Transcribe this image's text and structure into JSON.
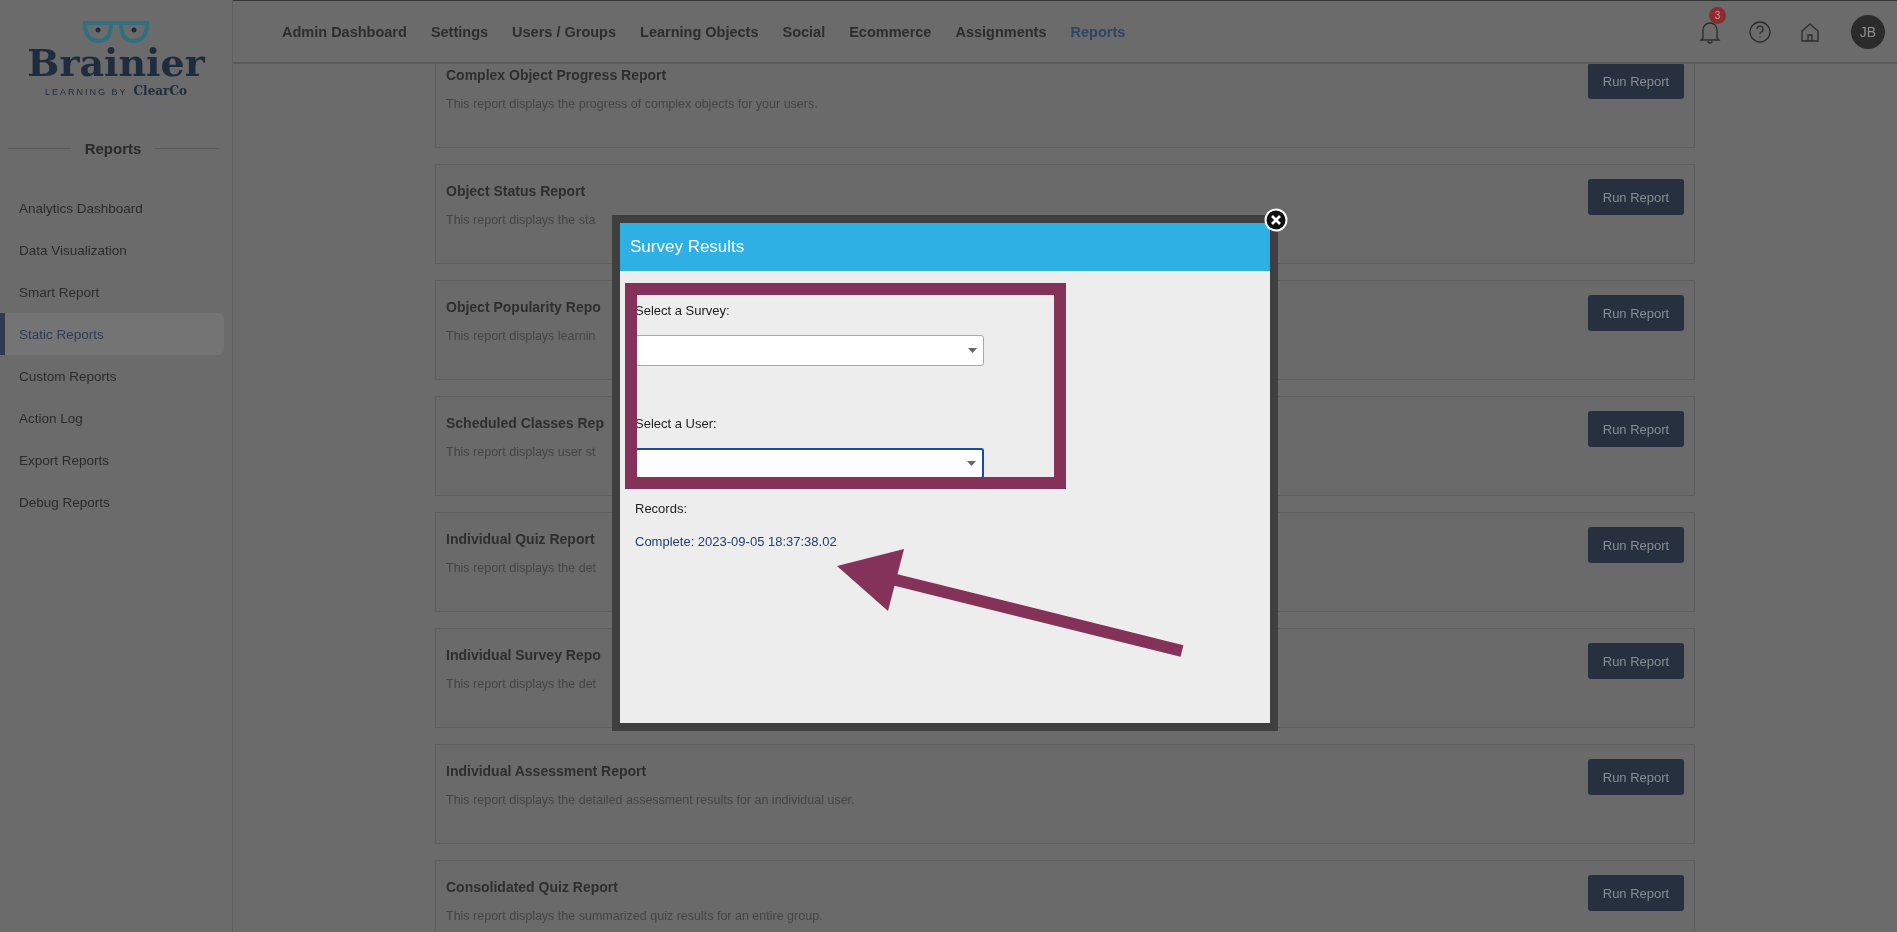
{
  "logo": {
    "name": "Brainier",
    "tagline": "LEARNING BY",
    "brand": "ClearCo"
  },
  "nav": [
    {
      "label": "Admin Dashboard",
      "selected": false
    },
    {
      "label": "Settings",
      "selected": false
    },
    {
      "label": "Users / Groups",
      "selected": false
    },
    {
      "label": "Learning Objects",
      "selected": false
    },
    {
      "label": "Social",
      "selected": false
    },
    {
      "label": "Ecommerce",
      "selected": false
    },
    {
      "label": "Assignments",
      "selected": false
    },
    {
      "label": "Reports",
      "selected": true
    }
  ],
  "header": {
    "notification_count": "3",
    "avatar": "JB"
  },
  "sidebar": {
    "heading": "Reports",
    "items": [
      {
        "label": "Analytics Dashboard",
        "selected": false
      },
      {
        "label": "Data Visualization",
        "selected": false
      },
      {
        "label": "Smart Report",
        "selected": false
      },
      {
        "label": "Static Reports",
        "selected": true
      },
      {
        "label": "Custom Reports",
        "selected": false
      },
      {
        "label": "Action Log",
        "selected": false
      },
      {
        "label": "Export Reports",
        "selected": false
      },
      {
        "label": "Debug Reports",
        "selected": false
      }
    ]
  },
  "reports": [
    {
      "title": "Complex Object Progress Report",
      "description": "This report displays the progress of complex objects for your users.",
      "button": "Run Report"
    },
    {
      "title": "Object Status Report",
      "description": "This report displays the sta",
      "button": "Run Report"
    },
    {
      "title": "Object Popularity Repo",
      "description": "This report displays learnin",
      "button": "Run Report"
    },
    {
      "title": "Scheduled Classes Rep",
      "description": "This report displays user st",
      "button": "Run Report"
    },
    {
      "title": "Individual Quiz Report",
      "description": "This report displays the det",
      "button": "Run Report"
    },
    {
      "title": "Individual Survey Repo",
      "description": "This report displays the det",
      "button": "Run Report"
    },
    {
      "title": "Individual Assessment Report",
      "description": "This report displays the detailed assessment results for an individual user.",
      "button": "Run Report"
    },
    {
      "title": "Consolidated Quiz Report",
      "description": "This report displays the summarized quiz results for an entire group.",
      "button": "Run Report"
    }
  ],
  "modal": {
    "title": "Survey Results",
    "fields": [
      {
        "label": "Select a Survey:",
        "focused": false
      },
      {
        "label": "Select a User:",
        "focused": true
      }
    ],
    "records_label": "Records:",
    "records": [
      "Complete: 2023-09-05 18:37:38.02"
    ]
  }
}
